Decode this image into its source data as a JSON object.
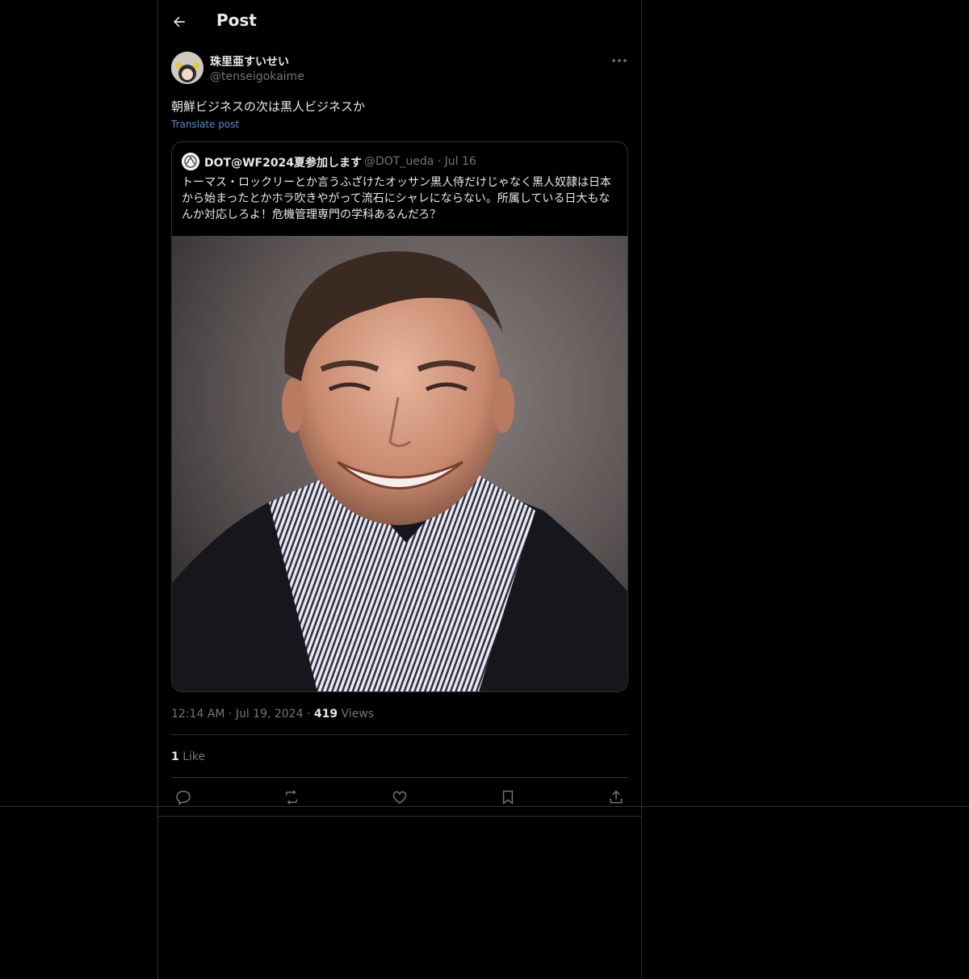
{
  "header": {
    "title": "Post",
    "back_icon": "arrow-left-icon"
  },
  "post": {
    "author_name": "珠里亜すいせい",
    "author_handle": "@tenseigokaime",
    "text": "朝鮮ビジネスの次は黒人ビジネスか",
    "translate_label": "Translate post",
    "time": "12:14 AM",
    "date": "Jul 19, 2024",
    "views_count": "419",
    "views_label": "Views",
    "likes_count": "1",
    "likes_label": "Like"
  },
  "quote": {
    "author_name": "DOT@WF2024夏参加します",
    "author_handle": "@DOT_ueda",
    "date": "Jul 16",
    "text": "トーマス・ロックリーとか言うふざけたオッサン黒人侍だけじゃなく黒人奴隷は日本から始まったとかホラ吹きやがって流石にシャレにならない。所属している日大もなんか対応しろよ！危機管理専門の学科あるんだろ？"
  },
  "actions": [
    "reply-icon",
    "repost-icon",
    "like-icon",
    "bookmark-icon",
    "share-icon"
  ],
  "colors": {
    "background": "#000000",
    "text": "#e7e9ea",
    "muted": "#71767b",
    "link": "#4c8fd6",
    "border": "#2f3336"
  }
}
